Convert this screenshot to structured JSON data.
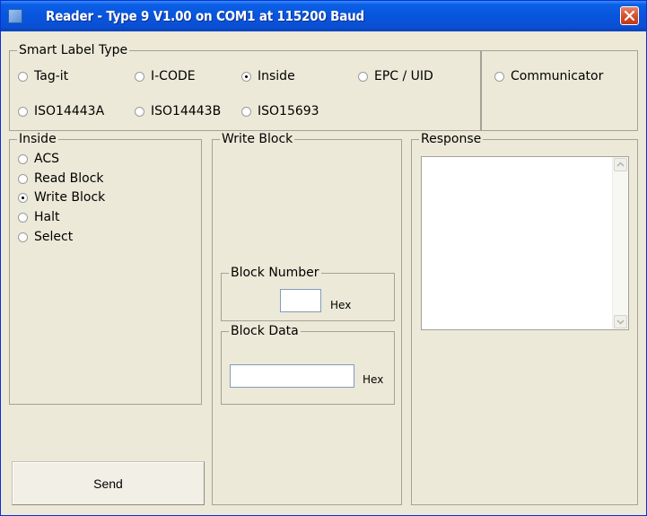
{
  "window": {
    "title": "Reader - Type 9 V1.00 on COM1 at 115200 Baud"
  },
  "smart_label_type": {
    "legend": "Smart Label Type",
    "options": [
      {
        "label": "Tag-it",
        "selected": false
      },
      {
        "label": "I-CODE",
        "selected": false
      },
      {
        "label": "Inside",
        "selected": true
      },
      {
        "label": "EPC / UID",
        "selected": false
      },
      {
        "label": "ISO14443A",
        "selected": false
      },
      {
        "label": "ISO14443B",
        "selected": false
      },
      {
        "label": "ISO15693",
        "selected": false
      }
    ],
    "communicator": {
      "label": "Communicator",
      "selected": false
    }
  },
  "inside": {
    "legend": "Inside",
    "options": [
      {
        "label": "ACS",
        "selected": false
      },
      {
        "label": "Read Block",
        "selected": false
      },
      {
        "label": "Write Block",
        "selected": true
      },
      {
        "label": "Halt",
        "selected": false
      },
      {
        "label": "Select",
        "selected": false
      }
    ]
  },
  "write_block": {
    "legend": "Write Block",
    "block_number": {
      "legend": "Block Number",
      "value": "",
      "unit": "Hex"
    },
    "block_data": {
      "legend": "Block Data",
      "value": "",
      "unit": "Hex"
    }
  },
  "response": {
    "legend": "Response",
    "value": ""
  },
  "send_button": {
    "label": "Send"
  },
  "colors": {
    "titlebar": "#0855dd",
    "window_bg": "#ece9d8",
    "close_button": "#d24a25"
  }
}
